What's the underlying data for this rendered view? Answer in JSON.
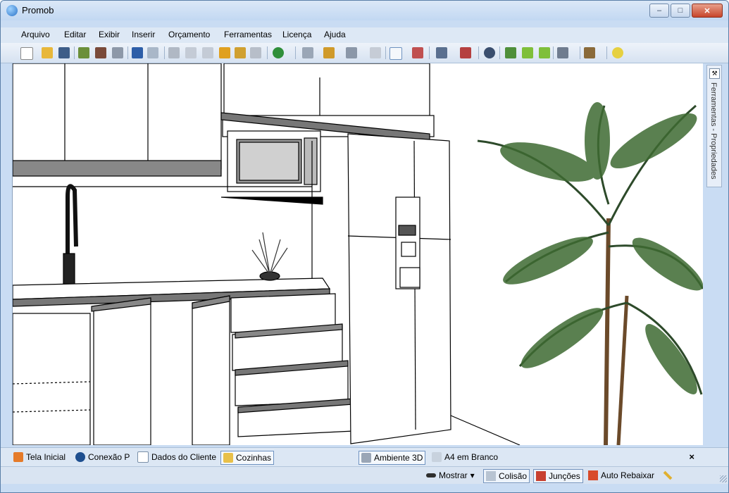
{
  "window": {
    "title": "Promob",
    "min": "–",
    "max": "□",
    "close": "✕"
  },
  "menu": [
    "Arquivo",
    "Editar",
    "Exibir",
    "Inserir",
    "Orçamento",
    "Ferramentas",
    "Licença",
    "Ajuda"
  ],
  "toolbar_icons": [
    "new-icon",
    "open-icon",
    "save-icon",
    "render-icon",
    "render2-icon",
    "print-icon",
    "undo-icon",
    "redo-icon",
    "cut-icon",
    "copy-icon",
    "paste-icon",
    "brush-icon",
    "paint-icon",
    "delete-icon",
    "budget-icon",
    "layout-icon",
    "modules-icon",
    "dimension-icon",
    "bar-icon",
    "select-icon",
    "measure-icon",
    "layers-icon",
    "height-icon",
    "view-icon",
    "rotate-icon",
    "arrow-left-icon",
    "arrow-right-icon",
    "window-icon",
    "box-icon",
    "light-icon"
  ],
  "side_panel": {
    "label": "Ferramentas - Propriedades"
  },
  "tabs": {
    "left": [
      {
        "label": "Tela Inicial"
      },
      {
        "label": "Conexão P"
      },
      {
        "label": "Dados do Cliente"
      },
      {
        "label": "Cozinhas"
      }
    ],
    "right": [
      {
        "label": "Ambiente 3D"
      },
      {
        "label": "A4 em Branco"
      }
    ],
    "close": "×"
  },
  "status": {
    "mostrar": "Mostrar",
    "colisao": "Colisão",
    "juncoes": "Junções",
    "auto_rebaixar": "Auto Rebaixar"
  },
  "colors": {
    "accent": "#2b73c8",
    "frame": "#c9dcf3",
    "close": "#c7452a"
  }
}
